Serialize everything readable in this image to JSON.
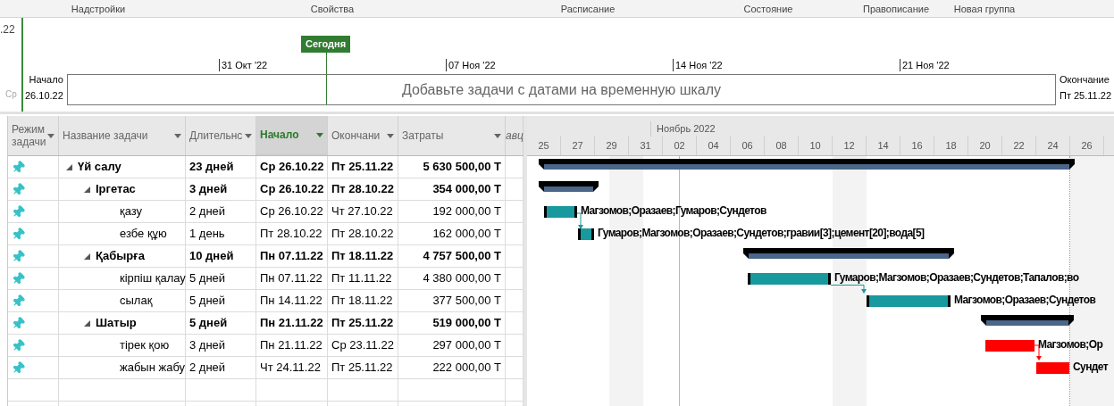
{
  "ribbon_groups": [
    "Надстройки",
    "Свойства",
    "Расписание",
    "Состояние",
    "Правописание",
    "Новая группа"
  ],
  "timeline": {
    "left_edge_date": ".22",
    "left_edge_day": "Ср",
    "today": "Сегодня",
    "ticks": [
      "31 Окт '22",
      "07 Ноя '22",
      "14 Ноя '22",
      "21 Ноя '22"
    ],
    "start_label": "Начало",
    "start_date": "26.10.22",
    "finish_label": "Окончание",
    "finish_date": "Пт 25.11.22",
    "placeholder": "Добавьте задачи с датами на временную шкалу"
  },
  "table": {
    "columns": [
      {
        "label": "Режим задачи",
        "selected": false
      },
      {
        "label": "Название задачи",
        "selected": false
      },
      {
        "label": "Длительнс",
        "selected": false
      },
      {
        "label": "Начало",
        "selected": true
      },
      {
        "label": "Окончани",
        "selected": false
      },
      {
        "label": "Затраты",
        "selected": false
      },
      {
        "label": "авц",
        "selected": false
      }
    ],
    "tasks": [
      {
        "name": "Үй салу",
        "duration": "23 дней",
        "start": "Ср 26.10.22",
        "finish": "Пт 25.11.22",
        "cost": "5 630 500,00 Т",
        "expanded": true,
        "children": [
          {
            "name": "Іргетас",
            "duration": "3 дней",
            "start": "Ср 26.10.22",
            "finish": "Пт 28.10.22",
            "cost": "354 000,00 Т",
            "expanded": true,
            "children": [
              {
                "name": "қазу",
                "duration": "2 дней",
                "start": "Ср 26.10.22",
                "finish": "Чт 27.10.22",
                "cost": "192 000,00 Т",
                "critical": false,
                "resources": "Магзомов;Оразаев;Гумаров;Сундетов"
              },
              {
                "name": "езбе құю",
                "duration": "1 день",
                "start": "Пт 28.10.22",
                "finish": "Пт 28.10.22",
                "cost": "162 000,00 Т",
                "critical": false,
                "resources": "Гумаров;Магзомов;Оразаев;Сундетов;гравии[3];цемент[20];вода[5]"
              }
            ]
          },
          {
            "name": "Қабырға",
            "duration": "10 дней",
            "start": "Пн 07.11.22",
            "finish": "Пт 18.11.22",
            "cost": "4 757 500,00 Т",
            "expanded": true,
            "children": [
              {
                "name": "кірпіш қалау",
                "duration": "5 дней",
                "start": "Пн 07.11.22",
                "finish": "Пт 11.11.22",
                "cost": "4 380 000,00 Т",
                "critical": false,
                "resources": "Гумаров;Магзомов;Оразаев;Сундетов;Тапалов;во"
              },
              {
                "name": "сылақ",
                "duration": "5 дней",
                "start": "Пн 14.11.22",
                "finish": "Пт 18.11.22",
                "cost": "377 500,00 Т",
                "critical": false,
                "resources": "Магзомов;Оразаев;Сундетов"
              }
            ]
          },
          {
            "name": "Шатыр",
            "duration": "5 дней",
            "start": "Пн 21.11.22",
            "finish": "Пт 25.11.22",
            "cost": "519 000,00 Т",
            "expanded": true,
            "children": [
              {
                "name": "тірек қою",
                "duration": "3 дней",
                "start": "Пн 21.11.22",
                "finish": "Ср 23.11.22",
                "cost": "297 000,00 Т",
                "critical": true,
                "resources": "Магзомов;Ор"
              },
              {
                "name": "жабын жабу",
                "duration": "2 дней",
                "start": "Чт 24.11.22",
                "finish": "Пт 25.11.22",
                "cost": "222 000,00 Т",
                "critical": true,
                "resources": "Сундет"
              }
            ]
          }
        ]
      }
    ]
  },
  "gantt": {
    "month": "Ноябрь 2022",
    "days": [
      "25",
      "27",
      "29",
      "31",
      "02",
      "04",
      "06",
      "08",
      "10",
      "12",
      "14",
      "16",
      "18",
      "20",
      "22",
      "24",
      "26"
    ]
  }
}
